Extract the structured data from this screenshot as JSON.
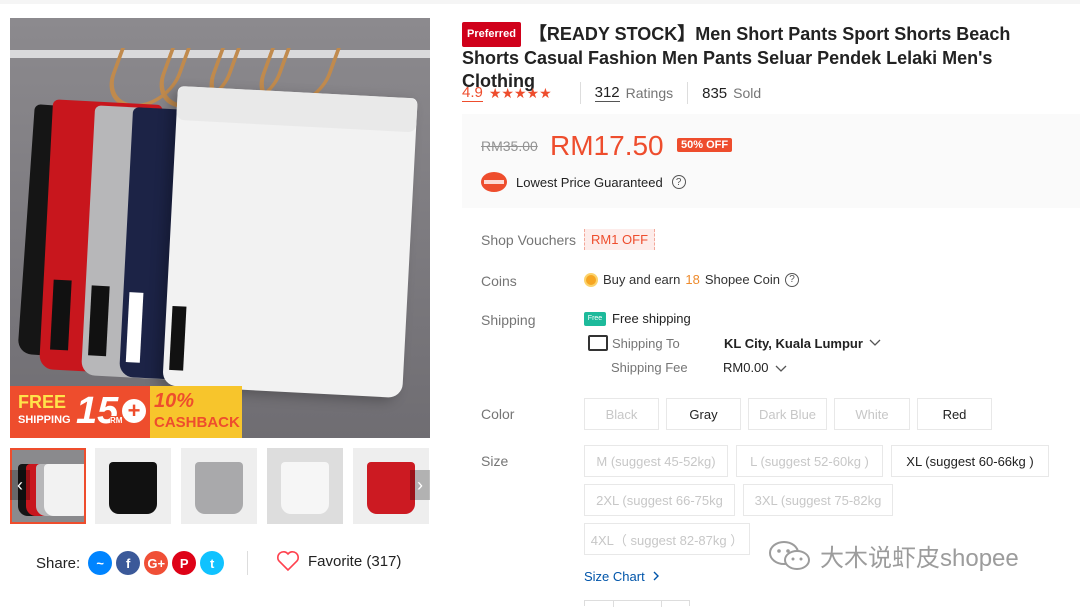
{
  "product": {
    "badge": "Preferred",
    "title": "【READY STOCK】Men Short Pants Sport Shorts Beach Shorts Casual Fashion Men Pants Seluar Pendek Lelaki Men's Clothing"
  },
  "rating": {
    "score": "4.9",
    "stars": "★★★★★",
    "ratings_count": "312",
    "ratings_label": "Ratings",
    "sold_count": "835",
    "sold_label": "Sold"
  },
  "price": {
    "original": "RM35.00",
    "current": "RM17.50",
    "discount": "50% OFF",
    "guarantee": "Lowest Price Guaranteed"
  },
  "promo_banner": {
    "free": "FREE",
    "shipping": "SHIPPING",
    "min": "15",
    "rm": "RM",
    "plus": "+",
    "cashback_pct": "10%",
    "cashback": "CASHBACK"
  },
  "vouchers": {
    "label": "Shop Vouchers",
    "value": "RM1 OFF"
  },
  "coins": {
    "label": "Coins",
    "prefix": "Buy and earn",
    "amount": "18",
    "suffix": "Shopee Coin"
  },
  "shipping": {
    "label": "Shipping",
    "free": "Free shipping",
    "free_icon_text": "Free",
    "to_label": "Shipping To",
    "to_value": "KL City, Kuala Lumpur",
    "fee_label": "Shipping Fee",
    "fee_value": "RM0.00"
  },
  "color": {
    "label": "Color",
    "options": [
      {
        "name": "Black",
        "enabled": false
      },
      {
        "name": "Gray",
        "enabled": true
      },
      {
        "name": "Dark Blue",
        "enabled": false
      },
      {
        "name": "White",
        "enabled": false
      },
      {
        "name": "Red",
        "enabled": true
      }
    ]
  },
  "size": {
    "label": "Size",
    "options": [
      {
        "name": "M (suggest 45-52kg)",
        "enabled": false
      },
      {
        "name": "L (suggest 52-60kg )",
        "enabled": false
      },
      {
        "name": "XL (suggest 60-66kg )",
        "enabled": true
      },
      {
        "name": "2XL (suggest 66-75kg",
        "enabled": false
      },
      {
        "name": "3XL (suggest 75-82kg",
        "enabled": false
      },
      {
        "name": "4XL（ suggest 82-87kg ）",
        "enabled": false
      }
    ],
    "chart_link": "Size Chart"
  },
  "share": {
    "label": "Share:"
  },
  "favorite": {
    "label": "Favorite (317)"
  },
  "watermark": {
    "text": "大木说虾皮shopee"
  },
  "colors": {
    "accent": "#ee4d2d",
    "link": "#0055aa"
  }
}
